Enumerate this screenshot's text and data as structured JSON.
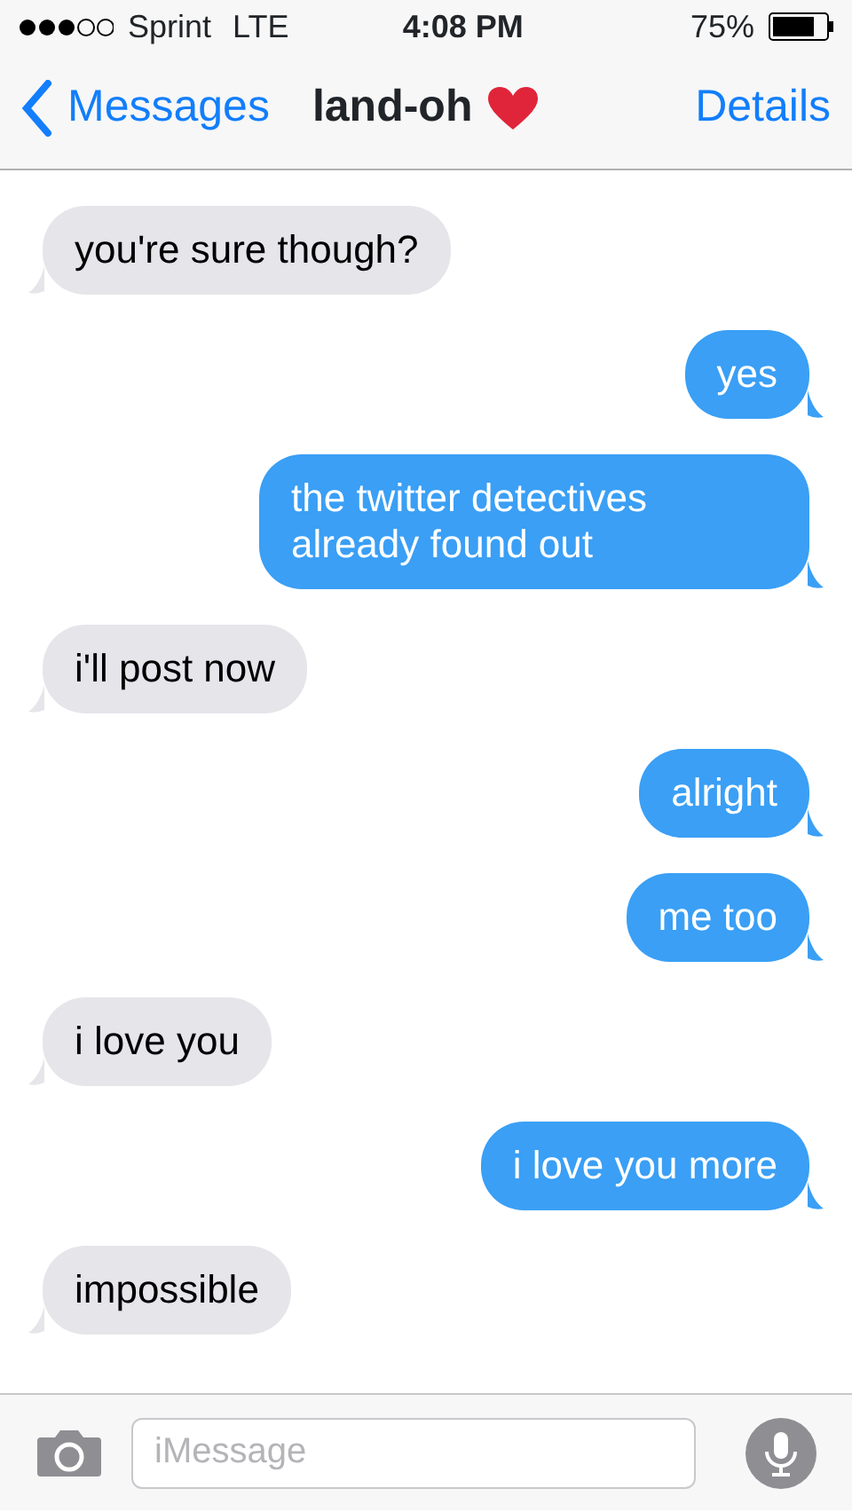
{
  "status_bar": {
    "carrier": "Sprint",
    "network": "LTE",
    "time": "4:08 PM",
    "battery": "75%"
  },
  "nav": {
    "back": "Messages",
    "title": "land-oh",
    "action": "Details"
  },
  "messages": [
    {
      "kind": "incoming",
      "text": "you're sure though?"
    },
    {
      "kind": "outgoing",
      "text": "yes"
    },
    {
      "kind": "outgoing",
      "text": "the twitter detectives already found out"
    },
    {
      "kind": "incoming",
      "text": "i'll post now"
    },
    {
      "kind": "outgoing",
      "text": "alright"
    },
    {
      "kind": "outgoing",
      "text": "me too"
    },
    {
      "kind": "incoming",
      "text": "i love you"
    },
    {
      "kind": "outgoing",
      "text": "i love you more"
    },
    {
      "kind": "incoming",
      "text": "impossible"
    }
  ],
  "composer": {
    "placeholder": "iMessage"
  }
}
